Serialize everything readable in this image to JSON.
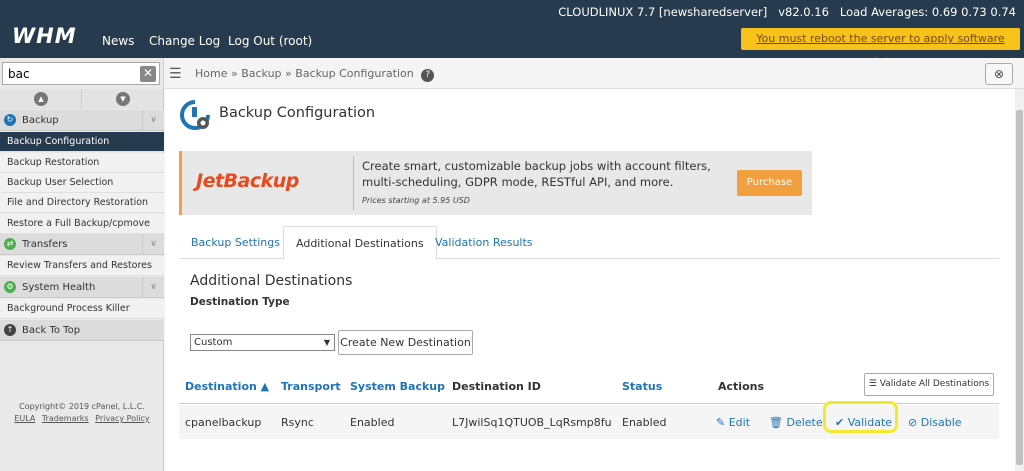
{
  "topbar": {
    "logo": "WHM",
    "nav": [
      "News",
      "Change Log",
      "Log Out (root)"
    ],
    "system_info": "CLOUDLINUX 7.7 [newsharedserver]   v82.0.16   Load Averages: 0.69 0.73 0.74",
    "reboot_notice": "You must reboot the server to apply software updates."
  },
  "sidebar": {
    "search_value": "bac",
    "clear_label": "✕",
    "categories": [
      {
        "label": "Backup",
        "icon": "backup-icon",
        "color": "#1f73b7",
        "items": [
          "Backup Configuration",
          "Backup Restoration",
          "Backup User Selection",
          "File and Directory Restoration",
          "Restore a Full Backup/cpmove File"
        ]
      },
      {
        "label": "Transfers",
        "icon": "transfers-icon",
        "color": "#4caf50",
        "items": [
          "Review Transfers and Restores"
        ]
      },
      {
        "label": "System Health",
        "icon": "system-health-icon",
        "color": "#4caf50",
        "items": [
          "Background Process Killer"
        ]
      }
    ],
    "back_to_top": "Back To Top",
    "copyright": "Copyright© 2019 cPanel, L.L.C.",
    "links": [
      "EULA",
      "Trademarks",
      "Privacy Policy"
    ]
  },
  "breadcrumb": {
    "items": [
      "Home",
      "Backup",
      "Backup Configuration"
    ],
    "sep": "»"
  },
  "page": {
    "title": "Backup Configuration",
    "promo": {
      "brand": "JetBackup",
      "text": "Create smart, customizable backup jobs with account filters, multi-scheduling, GDPR mode, RESTful API, and more.",
      "price": "Prices starting at 5.95 USD",
      "button": "Purchase"
    },
    "tabs": [
      {
        "label": "Backup Settings",
        "active": false
      },
      {
        "label": "Additional Destinations",
        "active": true
      },
      {
        "label": "Validation Results",
        "active": false
      }
    ],
    "section_title": "Additional Destinations",
    "dest_type_label": "Destination Type",
    "dest_type_value": "Custom",
    "create_button": "Create New Destination",
    "validate_all_button": "Validate All Destinations",
    "table": {
      "headers": [
        "Destination ▲",
        "Transport",
        "System Backup",
        "Destination ID",
        "Status",
        "Actions"
      ],
      "rows": [
        {
          "destination": "cpanelbackup",
          "transport": "Rsync",
          "system_backup": "Enabled",
          "destination_id": "L7JwilSq1QTUOB_LqRsmp8fu",
          "status": "Enabled",
          "actions": [
            "Edit",
            "Delete",
            "Validate",
            "Disable"
          ]
        }
      ]
    }
  },
  "colors": {
    "topbar": "#273b4e",
    "link": "#1f73b7",
    "reboot_bg": "#f6c21b",
    "brand_accent": "#f29f3f",
    "highlight": "#f3ea2f"
  }
}
